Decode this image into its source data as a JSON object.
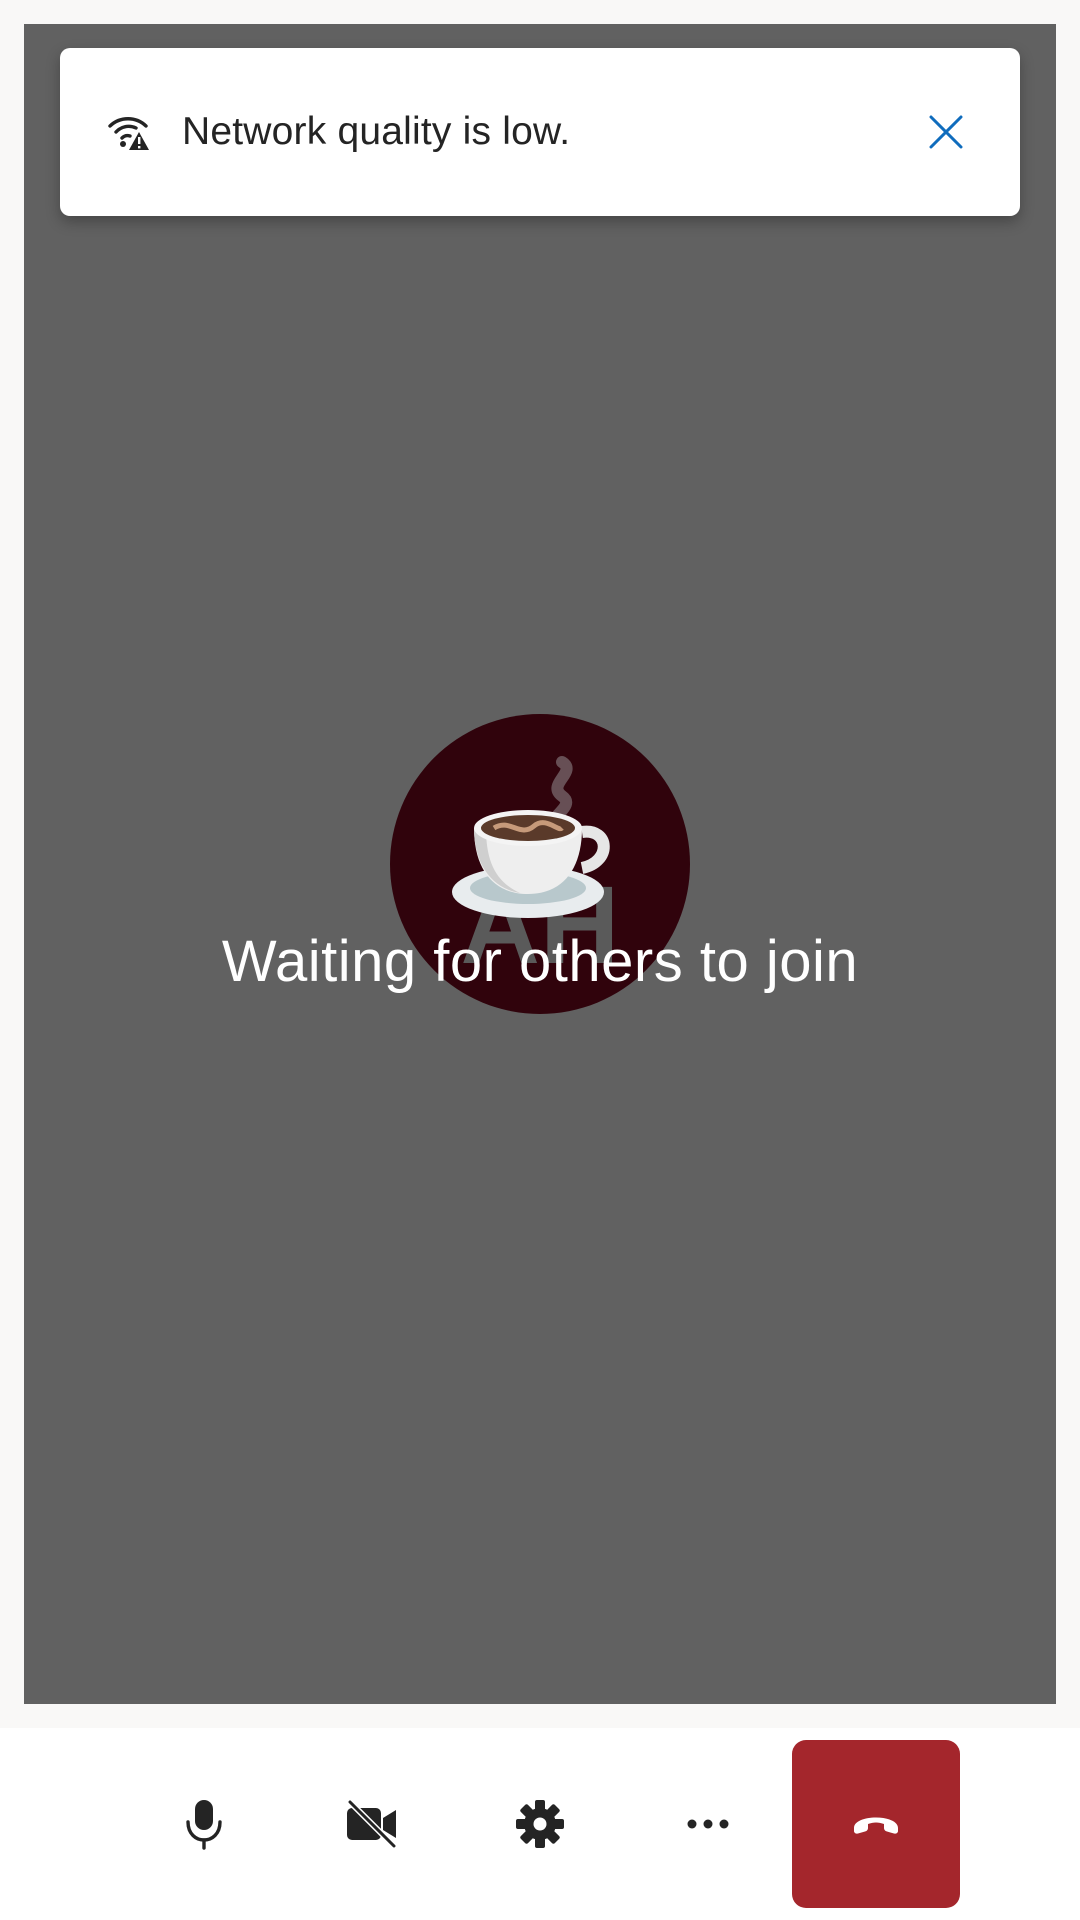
{
  "notification": {
    "message": "Network quality is low.",
    "icon": "network-warning-icon",
    "close_icon": "close-icon",
    "close_color": "#0f6cbd"
  },
  "participant": {
    "initials": "AH",
    "avatar_emoji": "coffee-cup-icon",
    "avatar_color": "#30030c"
  },
  "status": {
    "waiting_text": "Waiting for others to join"
  },
  "controls": {
    "microphone": "microphone-icon",
    "camera": "camera-off-icon",
    "settings": "gear-icon",
    "more": "more-icon",
    "hang_up": "hang-up-icon",
    "hang_up_color": "#a4262c"
  }
}
